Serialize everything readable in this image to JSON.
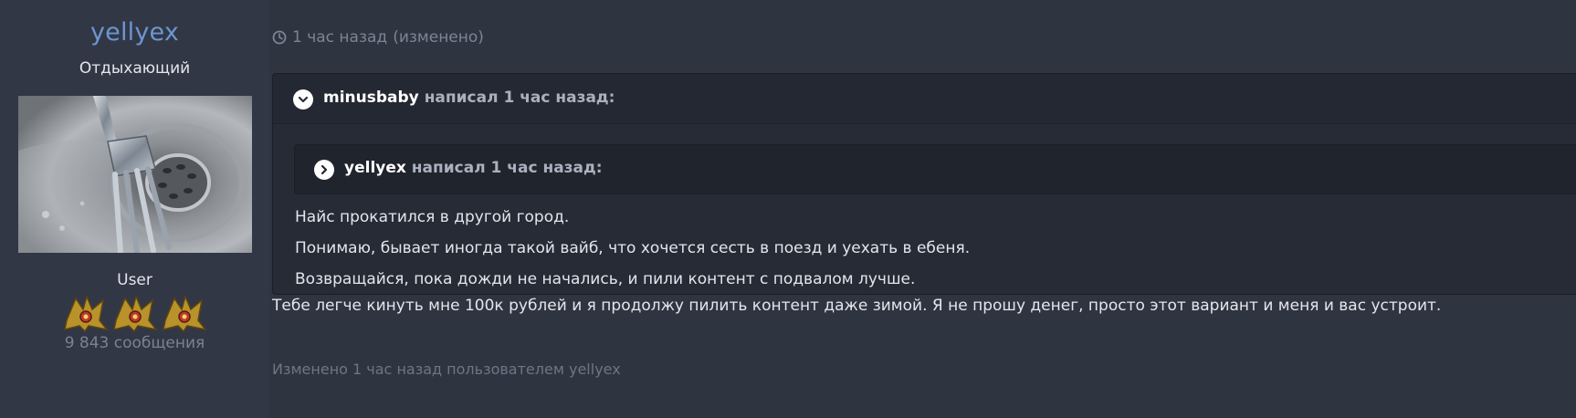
{
  "author": {
    "username": "yellyex",
    "title": "Отдыхающий",
    "avatar_icon": "fork-in-sink-avatar",
    "group": "User",
    "rank_icons": [
      "rank-badge-icon",
      "rank-badge-icon",
      "rank-badge-icon"
    ],
    "post_count": "9 843 сообщения"
  },
  "post": {
    "timestamp": "1 час назад",
    "edited_flag": "(изменено)",
    "quote": {
      "author": "minusbaby",
      "wrote": "написал 1 час назад:",
      "nested_quote": {
        "author": "yellyex",
        "wrote": "написал 1 час назад:"
      },
      "lines": [
        "Найс прокатился в другой город.",
        "Понимаю, бывает иногда такой вайб, что хочется сесть в поезд и уехать в ебеня.",
        "Возвращайся, пока дожди не начались, и пили контент с подвалом лучше."
      ]
    },
    "body": "Тебе легче кинуть мне 100к рублей и я продолжу пилить контент даже зимой. Я не прошу денег, просто этот вариант и меня и вас устроит.",
    "edited_note": "Изменено 1 час назад пользователем yellyex"
  },
  "colors": {
    "background": "#2f3441",
    "author_panel": "#323746",
    "username": "#6c96cf",
    "text": "#e3e6ec",
    "muted": "#7e8494",
    "quote_bg": "#272b36"
  }
}
